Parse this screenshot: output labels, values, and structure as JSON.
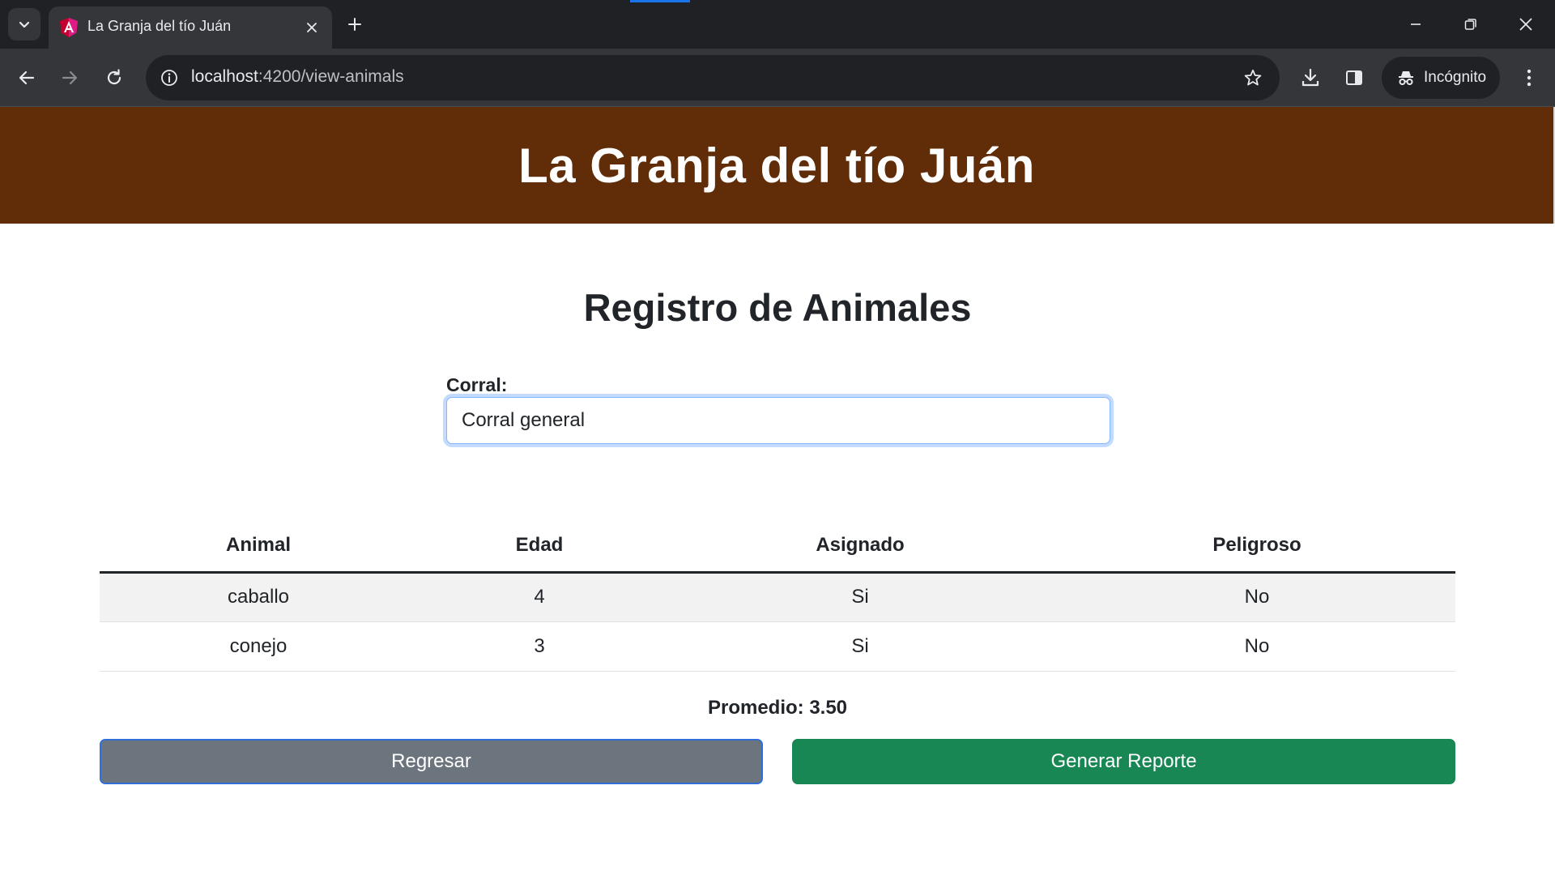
{
  "browser": {
    "tab_title": "La Granja del tío Juán",
    "url_host": "localhost",
    "url_rest": ":4200/view-animals",
    "profile_label": "Incógnito",
    "icons": [
      "chevron-down-icon",
      "angular-favicon",
      "close-icon",
      "plus-icon",
      "minimize-icon",
      "restore-icon",
      "close-window-icon",
      "back-arrow-icon",
      "forward-arrow-icon",
      "reload-icon",
      "site-info-icon",
      "bookmark-star-icon",
      "download-icon",
      "side-panel-icon",
      "incognito-icon",
      "kebab-menu-icon"
    ],
    "accent_color": "#1a73e8"
  },
  "header": {
    "title": "La Granja del tío Juán",
    "background_color": "#612d09"
  },
  "main": {
    "title": "Registro de Animales",
    "corral_label": "Corral:",
    "corral_value": "Corral general"
  },
  "table": {
    "headers": [
      "Animal",
      "Edad",
      "Asignado",
      "Peligroso"
    ],
    "rows": [
      [
        "caballo",
        "4",
        "Si",
        "No"
      ],
      [
        "conejo",
        "3",
        "Si",
        "No"
      ]
    ]
  },
  "summary": {
    "promedio": "Promedio: 3.50"
  },
  "buttons": {
    "back_label": "Regresar",
    "report_label": "Generar Reporte",
    "back_color": "#6c757d",
    "report_color": "#198754"
  }
}
